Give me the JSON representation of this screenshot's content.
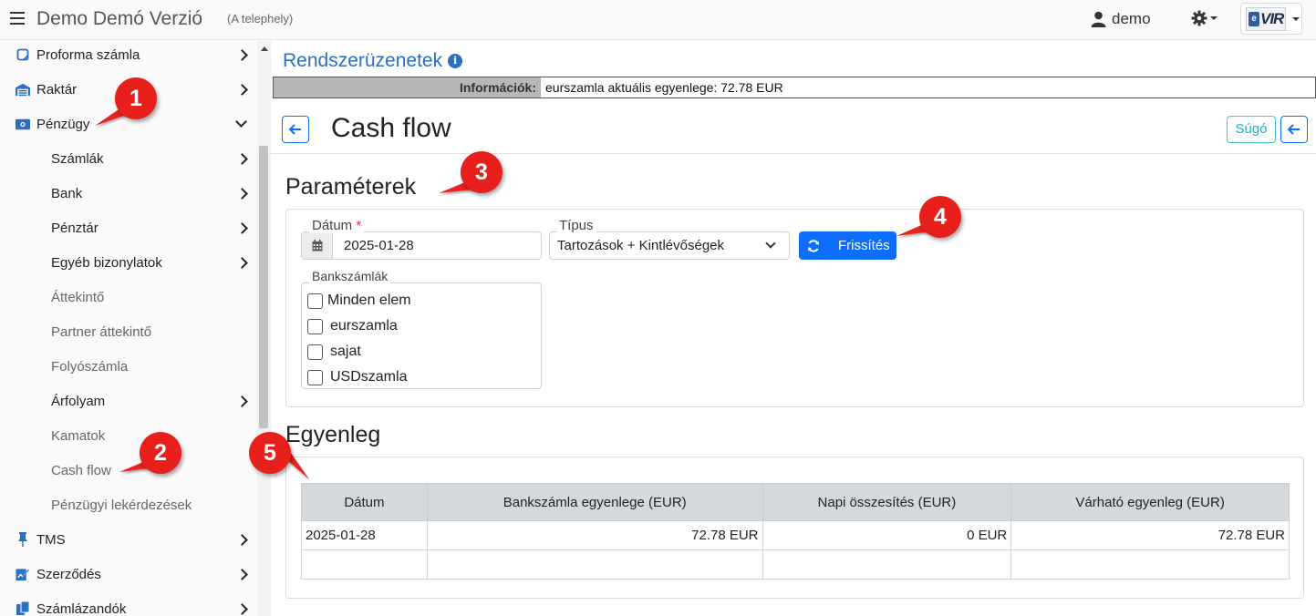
{
  "app": {
    "title": "Demo Demó Verzió",
    "subtitle": "(A telephely)"
  },
  "topbar": {
    "user_name": "demo",
    "logo_letter": "e",
    "logo_text": "VIR"
  },
  "sidebar": {
    "items": [
      {
        "label": "Proforma számla",
        "icon": "invoice-icon",
        "level": 0,
        "chevron": "right"
      },
      {
        "label": "Raktár",
        "icon": "warehouse-icon",
        "level": 0,
        "chevron": "right"
      },
      {
        "label": "Pénzügy",
        "icon": "money-icon",
        "level": 0,
        "chevron": "down"
      },
      {
        "label": "Számlák",
        "level": 1,
        "chevron": "right"
      },
      {
        "label": "Bank",
        "level": 1,
        "chevron": "right"
      },
      {
        "label": "Pénztár",
        "level": 1,
        "chevron": "right"
      },
      {
        "label": "Egyéb bizonylatok",
        "level": 1,
        "chevron": "right"
      },
      {
        "label": "Áttekintő",
        "level": 1,
        "chevron": ""
      },
      {
        "label": "Partner áttekintő",
        "level": 1,
        "chevron": ""
      },
      {
        "label": "Folyószámla",
        "level": 1,
        "chevron": ""
      },
      {
        "label": "Árfolyam",
        "level": 1,
        "chevron": "right"
      },
      {
        "label": "Kamatok",
        "level": 1,
        "chevron": ""
      },
      {
        "label": "Cash flow",
        "level": 1,
        "chevron": ""
      },
      {
        "label": "Pénzügyi lekérdezések",
        "level": 1,
        "chevron": ""
      },
      {
        "label": "TMS",
        "icon": "pin-icon",
        "level": 0,
        "chevron": "right"
      },
      {
        "label": "Szerződés",
        "icon": "contract-icon",
        "level": 0,
        "chevron": "right"
      },
      {
        "label": "Számlázandók",
        "icon": "copy-icon",
        "level": 0,
        "chevron": "right"
      }
    ]
  },
  "main": {
    "system_messages_title": "Rendszerüzenetek",
    "info_label": "Információk:",
    "info_message": "eurszamla aktuális egyenlege: 72.78 EUR",
    "page_title": "Cash flow",
    "help_label": "Súgó",
    "params": {
      "title": "Paraméterek",
      "date_label": "Dátum",
      "date_required": "*",
      "date_value": "2025-01-28",
      "type_label": "Típus",
      "type_value": "Tartozások + Kintlévőségek",
      "refresh_label": "Frissítés",
      "bank_accounts_label": "Bankszámlák",
      "bank_accounts": [
        "Minden elem",
        "eurszamla",
        "sajat",
        "USDszamla"
      ]
    },
    "balance": {
      "title": "Egyenleg",
      "columns": [
        "Dátum",
        "Bankszámla egyenlege (EUR)",
        "Napi összesítés (EUR)",
        "Várható egyenleg (EUR)"
      ],
      "rows": [
        [
          "2025-01-28",
          "72.78 EUR",
          "0 EUR",
          "72.78 EUR"
        ],
        [
          "",
          "",
          "",
          ""
        ]
      ]
    }
  },
  "annotations": [
    "1",
    "2",
    "3",
    "4",
    "5"
  ],
  "colors": {
    "primary": "#0d6efd",
    "link_blue": "#2a6fc2",
    "annotation_red": "#e8201b",
    "info_accent": "#19b4c7"
  }
}
